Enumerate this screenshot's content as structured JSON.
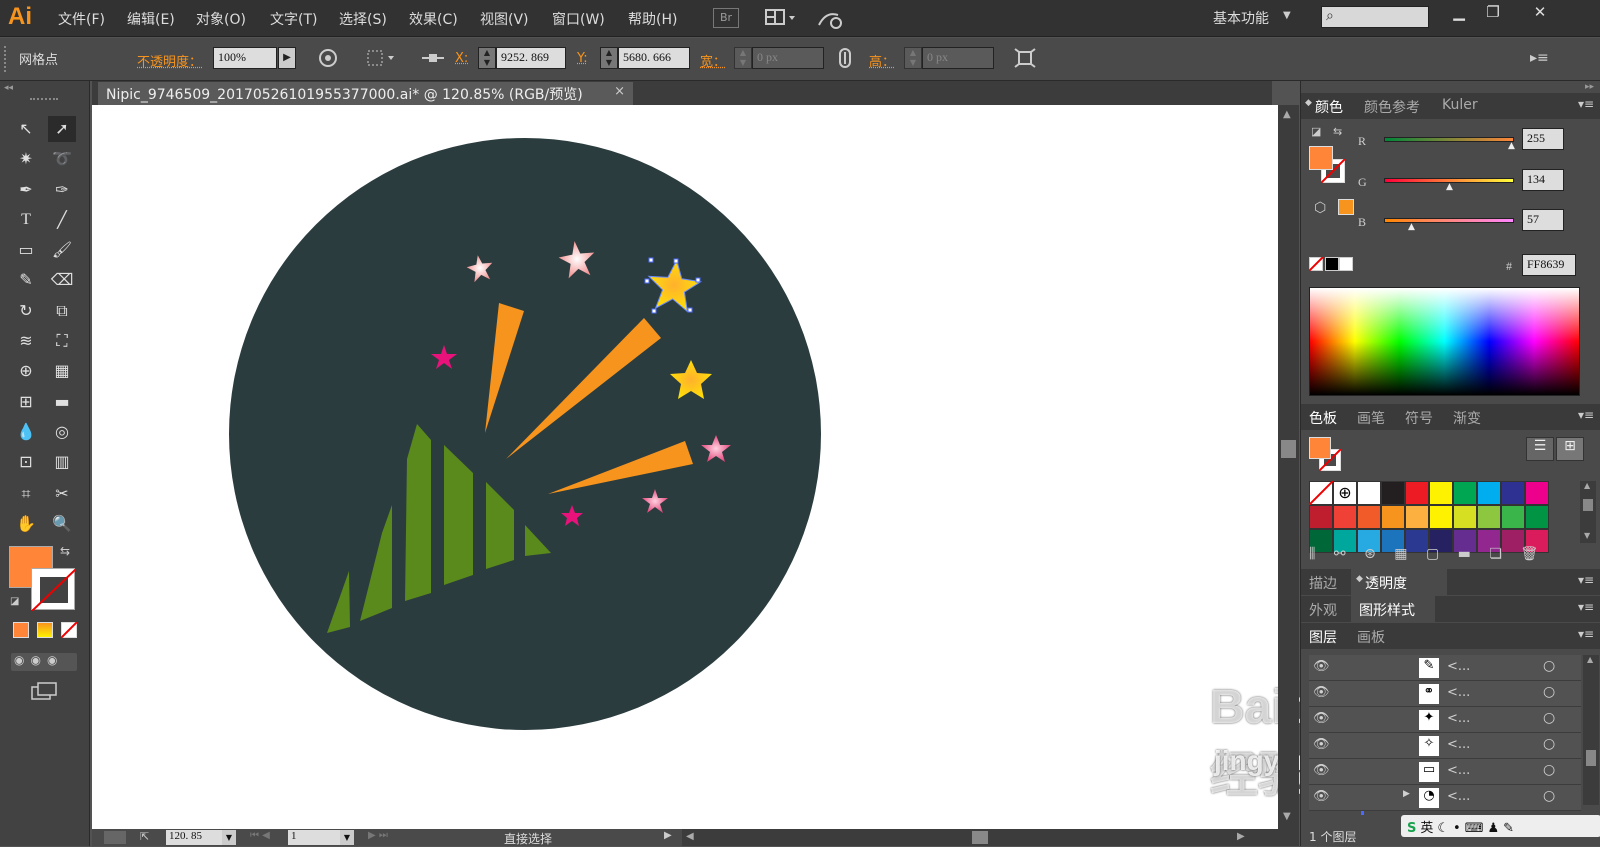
{
  "app": {
    "logo": "Ai",
    "workspace": "基本功能"
  },
  "menu": [
    "文件(F)",
    "编辑(E)",
    "对象(O)",
    "文字(T)",
    "选择(S)",
    "效果(C)",
    "视图(V)",
    "窗口(W)",
    "帮助(H)"
  ],
  "menu_extra": {
    "bridge": "Br"
  },
  "search": {
    "placeholder": ""
  },
  "controlbar": {
    "selection": "网格点",
    "opacity_label": "不透明度：",
    "opacity_value": "100%",
    "x_label": "X:",
    "x_value": "9252. 869",
    "y_label": "Y:",
    "y_value": "5680. 666",
    "w_label": "宽：",
    "w_value": "0 px",
    "h_label": "高：",
    "h_value": "0 px"
  },
  "document": {
    "tab_title": "Nipic_9746509_20170526101955377000.ai* @ 120.85% (RGB/预览)",
    "close": "×"
  },
  "statusbar": {
    "zoom": "120. 85",
    "page": "1",
    "tool": "直接选择"
  },
  "color_panel": {
    "tabs": [
      "颜色",
      "颜色参考",
      "Kuler"
    ],
    "r_label": "R",
    "r": "255",
    "g_label": "G",
    "g": "134",
    "b_label": "B",
    "b": "57",
    "hex_label": "#",
    "hex": "FF8639"
  },
  "swatches_panel": {
    "tabs": [
      "色板",
      "画笔",
      "符号",
      "渐变"
    ],
    "row1": [
      "#231f20",
      "#ed1c24",
      "#fff200",
      "#00a651",
      "#00aeef",
      "#2e3192",
      "#ec008c"
    ],
    "row2": [
      "#be1e2d",
      "#ef4136",
      "#f15a29",
      "#f7941d",
      "#fbb040",
      "#fff200",
      "#d7df23",
      "#8dc63f",
      "#39b54a",
      "#009444"
    ],
    "row3": [
      "#006838",
      "#00a79d",
      "#27aae1",
      "#1c75bc",
      "#2b3990",
      "#262262",
      "#662d91",
      "#92278f",
      "#9e1f63",
      "#da1c5c"
    ]
  },
  "stroke_panel": {
    "tabs": [
      "描边",
      "透明度"
    ]
  },
  "appearance_panel": {
    "tabs": [
      "外观",
      "图形样式"
    ]
  },
  "layers_panel": {
    "tabs": [
      "图层",
      "画板"
    ],
    "rows": [
      "<...",
      "<...",
      "<...",
      "<...",
      "<...",
      "<..."
    ],
    "footer": "1 个图层"
  },
  "watermark": {
    "logo": "Baidu经验",
    "url": "jingyan.baidu.com"
  },
  "colors": {
    "fill": "#ff8639",
    "artboard_circle": "#2b3c3f",
    "green": "#5a8a1c",
    "orange": "#f7941d"
  }
}
